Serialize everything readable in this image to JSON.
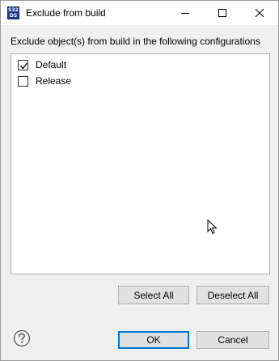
{
  "window": {
    "app_icon_text_top": "S32",
    "app_icon_text_bottom": "DS",
    "title": "Exclude from build",
    "controls": [
      "minimize-icon",
      "maximize-icon",
      "close-icon"
    ]
  },
  "prompt": "Exclude object(s) from build in the following configurations",
  "configurations": [
    {
      "label": "Default",
      "checked": true
    },
    {
      "label": "Release",
      "checked": false
    }
  ],
  "buttons": {
    "select_all": "Select All",
    "deselect_all": "Deselect All",
    "ok": "OK",
    "cancel": "Cancel"
  },
  "icons": {
    "help": "help-icon",
    "cursor": "mouse-pointer-icon"
  },
  "colors": {
    "accent": "#0078d7",
    "dialog_bg": "#f0f0f0",
    "button_bg": "#e1e1e1",
    "app_icon": "#1f3d8a"
  }
}
